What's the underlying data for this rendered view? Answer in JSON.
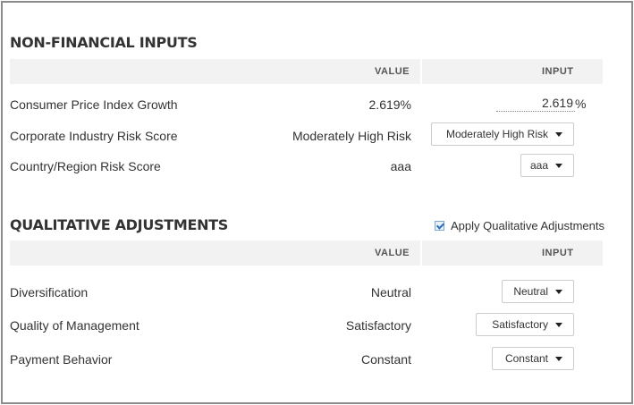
{
  "non_financial": {
    "title": "NON-FINANCIAL INPUTS",
    "col_value": "VALUE",
    "col_input": "INPUT",
    "rows": [
      {
        "label": "Consumer Price Index Growth",
        "value": "2.619%",
        "input_value": "2.619",
        "input_unit": "%"
      },
      {
        "label": "Corporate Industry Risk Score",
        "value": "Moderately High Risk",
        "input_value": "Moderately High Risk"
      },
      {
        "label": "Country/Region Risk Score",
        "value": "aaa",
        "input_value": "aaa"
      }
    ]
  },
  "qualitative": {
    "title": "QUALITATIVE ADJUSTMENTS",
    "checkbox_label": "Apply Qualitative Adjustments",
    "checkbox_checked": true,
    "col_value": "VALUE",
    "col_input": "INPUT",
    "rows": [
      {
        "label": "Diversification",
        "value": "Neutral",
        "input_value": "Neutral"
      },
      {
        "label": "Quality of Management",
        "value": "Satisfactory",
        "input_value": "Satisfactory"
      },
      {
        "label": "Payment Behavior",
        "value": "Constant",
        "input_value": "Constant"
      }
    ]
  },
  "colors": {
    "header_band": "#f2f2f2",
    "frame_border": "#8c8c8c",
    "checkbox_accent": "#2a6db5"
  }
}
